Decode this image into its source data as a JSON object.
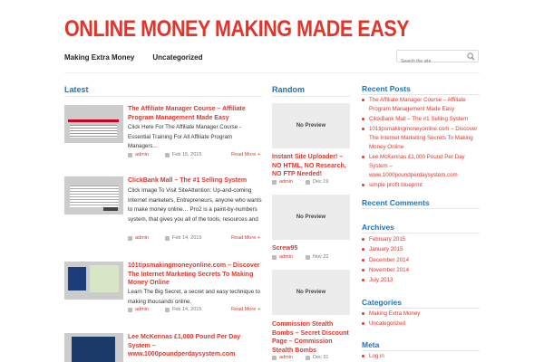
{
  "site": {
    "title": "ONLINE MONEY MAKING MADE EASY"
  },
  "nav": {
    "items": [
      "Making Extra Money",
      "Uncategorized"
    ]
  },
  "search": {
    "placeholder": "Search the site",
    "icon": "search-icon"
  },
  "latest": {
    "heading": "Latest",
    "posts": [
      {
        "title": "The Affiliate Manager Course – Affiliate Program Management Made Easy",
        "excerpt": "Click Here For The Affiliate Manager Course - Essential Training For All Affiliate Program Managers...",
        "author": "admin",
        "date": "Feb 15, 2015",
        "more": "Read More +"
      },
      {
        "title": "ClickBank Mall – The #1 Selling System",
        "excerpt": "Click Image To Visit SiteAttention: Up-and-coming Internet marketers, Entrepreneurs, anyone who wants to make money online… Pro2 is a paint-by-numbers system, that gives you all of the tools, resources and",
        "author": "admin",
        "date": "Feb 14, 2015",
        "more": "Read More +"
      },
      {
        "title": "101tipsmakingmoneyonline.com – Discover The Internet Marketing Secrets To Making Money Online",
        "excerpt": "Learn The Big Secret, a secret and easy technique to making thousands online.",
        "author": "admin",
        "date": "Feb 14, 2015",
        "more": "Read More +"
      },
      {
        "title": "Lee McKennas £1,000 Pound Per Day System – www.1000poundperdaysystem.com",
        "excerpt": "",
        "author": "",
        "date": "",
        "more": ""
      }
    ]
  },
  "random": {
    "heading": "Random",
    "posts": [
      {
        "preview": "No Preview",
        "title": "Instant Site Uploader! – NO HTML, NO Research, NO FTP Needed!",
        "author": "admin",
        "date": "Dec 19"
      },
      {
        "preview": "No Preview",
        "title": "Screw95",
        "author": "admin",
        "date": "Nov 22"
      },
      {
        "preview": "No Preview",
        "title": "Commission Stealth Bombs – Secret Discount Page – Commission Stealth Bombs",
        "author": "admin",
        "date": "Dec 31"
      }
    ]
  },
  "sidebar": {
    "recent_posts": {
      "heading": "Recent Posts",
      "items": [
        "The Affiliate Manager Course – Affiliate Program Management Made Easy",
        "ClickBank Mall – The #1 Selling System",
        "101tipsmakingmoneyonline.com – Discover The Internet Marketing Secrets To Making Money Online",
        "Lee McKennas £1,000 Pound Per Day System – www.1000poundperdaysystem.com",
        "simple profit blueprint"
      ]
    },
    "recent_comments": {
      "heading": "Recent Comments"
    },
    "archives": {
      "heading": "Archives",
      "items": [
        "February 2015",
        "January 2015",
        "December 2014",
        "November 2014",
        "July 2013"
      ]
    },
    "categories": {
      "heading": "Categories",
      "items": [
        "Making Extra Money",
        "Uncategorized"
      ]
    },
    "meta": {
      "heading": "Meta",
      "items": [
        "Log in"
      ]
    }
  },
  "colors": {
    "accent": "#e4342a",
    "heading_blue": "#1e73be"
  }
}
